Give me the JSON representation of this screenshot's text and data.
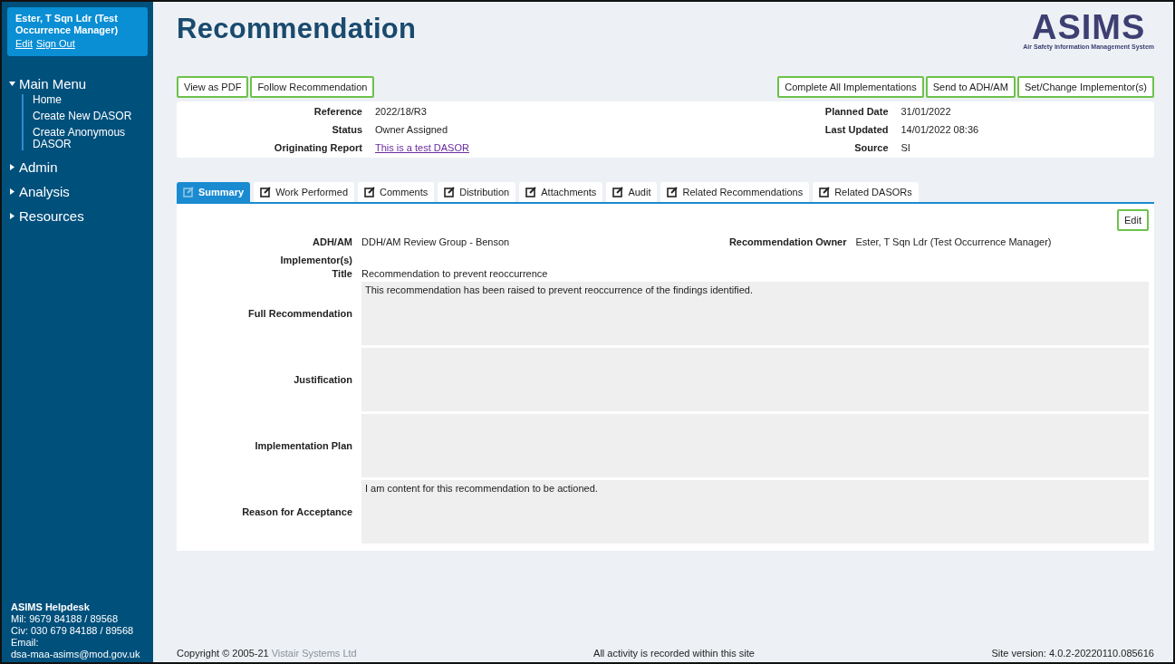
{
  "user": {
    "name": "Ester, T Sqn Ldr (Test Occurrence Manager)",
    "links": [
      "Edit",
      "Sign Out"
    ]
  },
  "sidebar": {
    "sections": [
      {
        "label": "Main Menu",
        "expanded": true,
        "items": [
          "Home",
          "Create New DASOR",
          "Create Anonymous DASOR"
        ]
      },
      {
        "label": "Admin",
        "expanded": false
      },
      {
        "label": "Analysis",
        "expanded": false
      },
      {
        "label": "Resources",
        "expanded": false
      }
    ],
    "helpdesk": {
      "title": "ASIMS Helpdesk",
      "lines": [
        "Mil: 9679 84188 / 89568",
        "Civ: 030 679 84188 / 89568"
      ],
      "email_label": "Email:",
      "email": "dsa-maa-asims@mod.gov.uk"
    }
  },
  "page": {
    "title": "Recommendation",
    "logo": {
      "name": "ASIMS",
      "tagline": "Air Safety Information Management System"
    }
  },
  "actions_left": [
    "View as PDF",
    "Follow Recommendation"
  ],
  "actions_right": [
    "Complete All Implementations",
    "Send to ADH/AM",
    "Set/Change Implementor(s)"
  ],
  "details_left": [
    {
      "label": "Reference",
      "value": "2022/18/R3",
      "kind": "text"
    },
    {
      "label": "Status",
      "value": "Owner Assigned",
      "kind": "text"
    },
    {
      "label": "Originating Report",
      "value": "This is a test DASOR",
      "kind": "link"
    }
  ],
  "details_right": [
    {
      "label": "Planned Date",
      "value": "31/01/2022"
    },
    {
      "label": "Last Updated",
      "value": "14/01/2022 08:36"
    },
    {
      "label": "Source",
      "value": "SI"
    }
  ],
  "tabs": [
    {
      "label": "Summary",
      "selected": true
    },
    {
      "label": "Work Performed",
      "selected": false
    },
    {
      "label": "Comments",
      "selected": false
    },
    {
      "label": "Distribution",
      "selected": false
    },
    {
      "label": "Attachments",
      "selected": false
    },
    {
      "label": "Audit",
      "selected": false
    },
    {
      "label": "Related Recommendations",
      "selected": false
    },
    {
      "label": "Related DASORs",
      "selected": false
    }
  ],
  "summary": {
    "edit_button": "Edit",
    "top_fields": [
      {
        "label": "ADH/AM",
        "value": "DDH/AM Review Group - Benson"
      },
      {
        "label": "Recommendation Owner",
        "value": "Ester, T Sqn Ldr (Test Occurrence Manager)"
      }
    ],
    "fields": [
      {
        "label": "Implementor(s)",
        "kind": "text"
      },
      {
        "label": "Title",
        "value": "Recommendation to prevent reoccurrence",
        "kind": "text"
      },
      {
        "label": "Full Recommendation",
        "value": "This recommendation has been raised to prevent reoccurrence of the findings identified.",
        "kind": "area"
      },
      {
        "label": "Justification",
        "kind": "area"
      },
      {
        "label": "Implementation Plan",
        "kind": "area"
      },
      {
        "label": "Reason for Acceptance",
        "value": "I am content for this recommendation to be actioned.",
        "kind": "area"
      }
    ]
  },
  "footer": {
    "copyright": "Copyright © 2005-21",
    "company": "Vistair Systems Ltd",
    "notice": "All activity is recorded within this site",
    "version": "Site version: 4.0.2-20220110.085616"
  }
}
